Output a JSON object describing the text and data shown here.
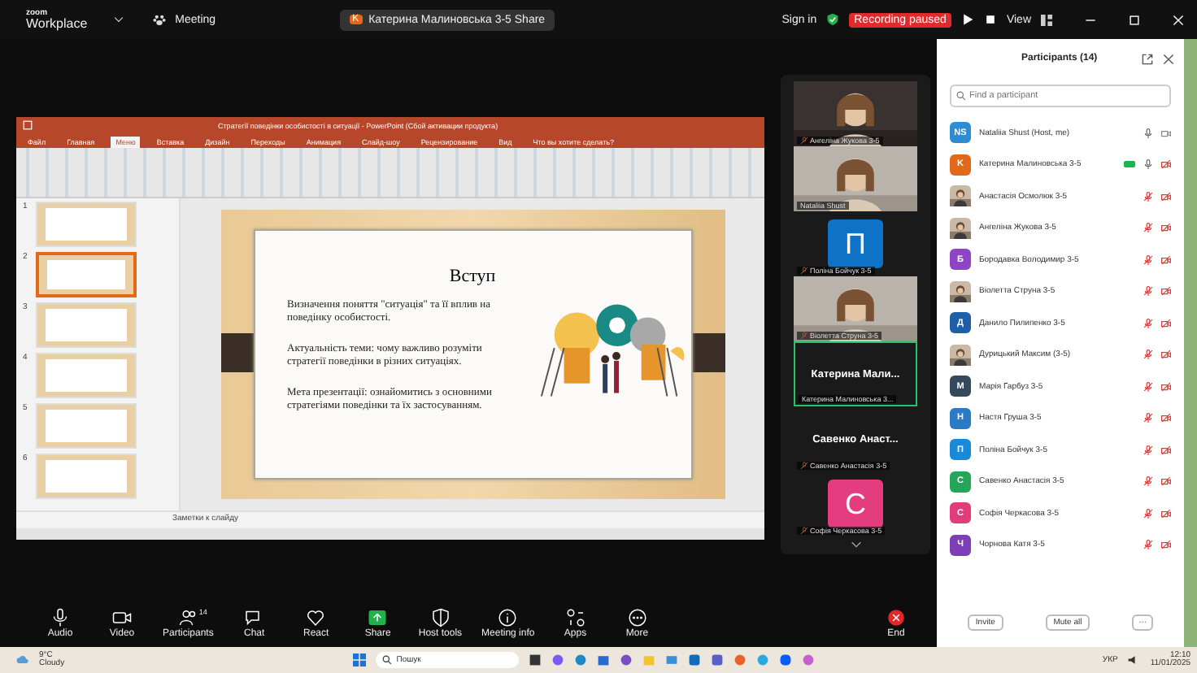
{
  "topbar": {
    "logo_top": "zoom",
    "logo_bottom": "Workplace",
    "meeting": "Meeting",
    "share_badge": "K",
    "share_label": "Катерина Малиновська 3-5 Share",
    "sign_in": "Sign in",
    "recording": "Recording paused",
    "view": "View"
  },
  "powerpoint": {
    "title": "Стратегії поведінки особистості в ситуації - PowerPoint (Сбой активации продукта)",
    "tabs": [
      {
        "label": "Файл",
        "selected": false
      },
      {
        "label": "Главная",
        "selected": false
      },
      {
        "label": "Меню",
        "selected": true
      },
      {
        "label": "Вставка",
        "selected": false
      },
      {
        "label": "Дизайн",
        "selected": false
      },
      {
        "label": "Переходы",
        "selected": false
      },
      {
        "label": "Анимация",
        "selected": false
      },
      {
        "label": "Слайд-шоу",
        "selected": false
      },
      {
        "label": "Рецензирование",
        "selected": false
      },
      {
        "label": "Вид",
        "selected": false
      },
      {
        "label": "Что вы хотите сделать?",
        "selected": false
      }
    ],
    "thumbnails": [
      {
        "number": "1",
        "selected": false
      },
      {
        "number": "2",
        "selected": true
      },
      {
        "number": "3",
        "selected": false
      },
      {
        "number": "4",
        "selected": false
      },
      {
        "number": "5",
        "selected": false
      },
      {
        "number": "6",
        "selected": false
      }
    ],
    "slide": {
      "title": "Вступ",
      "paragraphs": [
        "Визначення поняття \"ситуація\" та її вплив на поведінку особистості.",
        "Актуальність теми: чому важливо розуміти стратегії поведінки в різних ситуаціях.",
        "Мета презентації: ознайомитись з основними стратегіями поведінки та їх застосуванням."
      ]
    },
    "notes": "Заметки к слайду"
  },
  "video_tiles": [
    {
      "kind": "picture",
      "name": "Ангеліна Жукова 3-5",
      "muted": true,
      "selected": false
    },
    {
      "kind": "picture",
      "name": "Nataliia Shust",
      "muted": false,
      "selected": false
    },
    {
      "kind": "letter",
      "letter": "П",
      "color": "#0e72c6",
      "name": "Поліна Бойчук 3-5",
      "muted": true,
      "selected": false
    },
    {
      "kind": "picture",
      "name": "Віолетта Струна 3-5",
      "muted": true,
      "selected": false
    },
    {
      "kind": "name",
      "big": "Катерина  Мали...",
      "name": "Катерина Малиновська 3...",
      "muted": false,
      "selected": true
    },
    {
      "kind": "name",
      "big": "Савенко  Анаст...",
      "name": "Савенко Анастасія 3-5",
      "muted": true,
      "selected": false
    },
    {
      "kind": "letter",
      "letter": "С",
      "color": "#e33d7f",
      "name": "Софія Черкасова 3-5",
      "muted": true,
      "selected": false
    }
  ],
  "toolbar": [
    {
      "kind": "audio",
      "label": "Audio"
    },
    {
      "kind": "video",
      "label": "Video"
    },
    {
      "kind": "participants",
      "label": "Participants",
      "count": "14"
    },
    {
      "kind": "chat",
      "label": "Chat"
    },
    {
      "kind": "react",
      "label": "React"
    },
    {
      "kind": "share",
      "label": "Share"
    },
    {
      "kind": "host",
      "label": "Host tools"
    },
    {
      "kind": "info",
      "label": "Meeting info"
    },
    {
      "kind": "apps",
      "label": "Apps"
    },
    {
      "kind": "more",
      "label": "More"
    },
    {
      "kind": "end",
      "label": "End"
    }
  ],
  "participants": {
    "title": "Participants (14)",
    "search": {
      "placeholder": "Find a participant"
    },
    "items": [
      {
        "kind": "letter",
        "initials": "NS",
        "color": "#2d8cd2",
        "name": "Nataliia Shust (Host, me)",
        "mic_muted": false,
        "video_off": false,
        "speaking": false
      },
      {
        "kind": "letter",
        "initials": "K",
        "color": "#e2691a",
        "name": "Катерина Малиновська 3-5",
        "mic_muted": false,
        "video_off": true,
        "speaking": true
      },
      {
        "kind": "picture",
        "name": "Анастасія Осмолюк 3-5",
        "mic_muted": true,
        "video_off": true,
        "speaking": false
      },
      {
        "kind": "picture",
        "name": "Ангеліна Жукова 3-5",
        "mic_muted": true,
        "video_off": true,
        "speaking": false
      },
      {
        "kind": "letter",
        "initials": "Б",
        "color": "#8e44c4",
        "name": "Бородавка Володимир 3-5",
        "mic_muted": true,
        "video_off": true,
        "speaking": false
      },
      {
        "kind": "picture",
        "name": "Віолетта Струна 3-5",
        "mic_muted": true,
        "video_off": true,
        "speaking": false
      },
      {
        "kind": "letter",
        "initials": "Д",
        "color": "#1f5fa8",
        "name": "Данило Пилипенко 3-5",
        "mic_muted": true,
        "video_off": true,
        "speaking": false
      },
      {
        "kind": "picture",
        "name": "Дурицький Максим (3-5)",
        "mic_muted": true,
        "video_off": true,
        "speaking": false
      },
      {
        "kind": "letter",
        "initials": "М",
        "color": "#35495e",
        "name": "Марія Гарбуз 3-5",
        "mic_muted": true,
        "video_off": true,
        "speaking": false
      },
      {
        "kind": "letter",
        "initials": "Н",
        "color": "#2a7bc4",
        "name": "Настя Груша 3-5",
        "mic_muted": true,
        "video_off": true,
        "speaking": false
      },
      {
        "kind": "letter",
        "initials": "П",
        "color": "#1a8ad8",
        "name": "Поліна Бойчук 3-5",
        "mic_muted": true,
        "video_off": true,
        "speaking": false
      },
      {
        "kind": "letter",
        "initials": "С",
        "color": "#23a55a",
        "name": "Савенко Анастасія 3-5",
        "mic_muted": true,
        "video_off": true,
        "speaking": false
      },
      {
        "kind": "letter",
        "initials": "С",
        "color": "#e23d7a",
        "name": "Софія Черкасова 3-5",
        "mic_muted": true,
        "video_off": true,
        "speaking": false
      },
      {
        "kind": "letter",
        "initials": "Ч",
        "color": "#7d3fb5",
        "name": "Чорнова Катя 3-5",
        "mic_muted": true,
        "video_off": true,
        "speaking": false
      }
    ],
    "buttons": [
      "Invite",
      "Mute all"
    ],
    "more": "···"
  },
  "taskbar": {
    "temp": "9°C",
    "weather": "Cloudy",
    "search": "Пошук",
    "lang": "УКР",
    "time": "12:10",
    "date": "11/01/2025"
  }
}
